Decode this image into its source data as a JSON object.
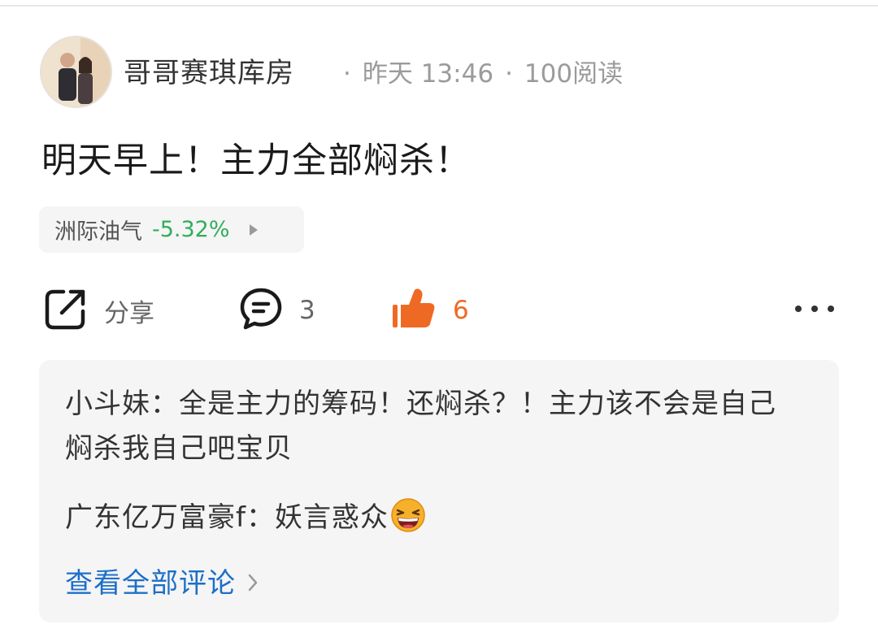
{
  "post": {
    "author": "哥哥赛琪库房",
    "time": "昨天 13:46",
    "reads": "100阅读",
    "meta_separator": "·",
    "content": "明天早上！主力全部焖杀！"
  },
  "stock": {
    "name": "洲际油气",
    "change": "-5.32%",
    "change_color": "#2fae5c"
  },
  "actions": {
    "share_label": "分享",
    "comment_count": "3",
    "like_count": "6",
    "like_color": "#ee6a24",
    "share_icon": "share-icon",
    "comment_icon": "comment-icon",
    "like_icon": "thumbs-up-icon",
    "more_icon": "more-icon"
  },
  "comments": [
    {
      "author": "小斗妹",
      "text": "全是主力的筹码！还焖杀？！主力该不会是自己焖杀我自己吧宝贝"
    },
    {
      "author": "广东亿万富豪f",
      "text": "妖言惑众",
      "emoji": "laughing-emoji"
    }
  ],
  "comment_separator": "：",
  "view_all_label": "查看全部评论"
}
